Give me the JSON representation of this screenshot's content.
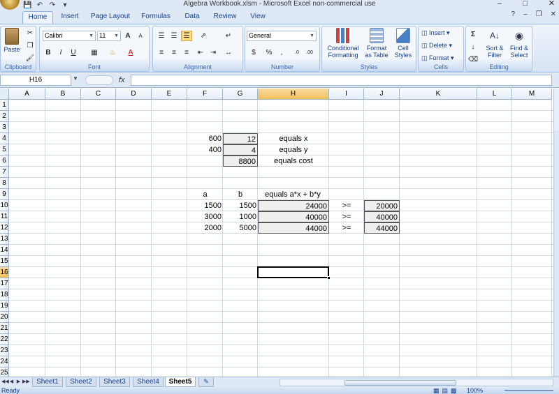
{
  "window": {
    "title": "Algebra Workbook.xlsm  -  Microsoft Excel non-commercial use",
    "buttons": [
      "–",
      "□",
      "✕"
    ]
  },
  "qat": [
    "save-icon",
    "undo-icon",
    "redo-icon",
    "customize-icon"
  ],
  "tabs": [
    "Home",
    "Insert",
    "Page Layout",
    "Formulas",
    "Data",
    "Review",
    "View"
  ],
  "ribbon": {
    "clipboard": {
      "paste": "Paste",
      "label": "Clipboard"
    },
    "font": {
      "name": "Calibri",
      "size": "11",
      "bold": "B",
      "italic": "I",
      "underline": "U",
      "label": "Font"
    },
    "alignment": {
      "label": "Alignment"
    },
    "number": {
      "format": "General",
      "currency": "$",
      "percent": "%",
      "comma": ",",
      "label": "Number"
    },
    "styles": {
      "conditional": "Conditional",
      "conditional2": "Formatting",
      "format_table": "Format",
      "format_table2": "as Table",
      "cell_styles": "Cell",
      "cell_styles2": "Styles",
      "label": "Styles"
    },
    "cells": {
      "insert": "Insert",
      "delete": "Delete",
      "format": "Format",
      "label": "Cells"
    },
    "editing": {
      "sort": "Sort &",
      "sort2": "Filter",
      "find": "Find &",
      "find2": "Select",
      "sigma": "Σ",
      "label": "Editing"
    }
  },
  "formula_bar": {
    "name_box": "H16",
    "fx": "fx",
    "formula": ""
  },
  "columns": [
    "A",
    "B",
    "C",
    "D",
    "E",
    "F",
    "G",
    "H",
    "I",
    "J",
    "K",
    "L",
    "M"
  ],
  "rows": [
    "1",
    "2",
    "3",
    "4",
    "5",
    "6",
    "7",
    "8",
    "9",
    "10",
    "11",
    "12",
    "13",
    "14",
    "15",
    "16",
    "17",
    "18",
    "19",
    "20",
    "21",
    "22",
    "23",
    "24",
    "25"
  ],
  "selected": {
    "column": "H",
    "row": "16"
  },
  "cells": {
    "F4": "600",
    "G4": "12",
    "H4": "equals x",
    "F5": "400",
    "G5": "4",
    "H5": "equals y",
    "G6": "8800",
    "H6": "equals cost",
    "F9": "a",
    "G9": "b",
    "H9": "equals a*x + b*y",
    "F10": "1500",
    "G10": "1500",
    "H10": "24000",
    "I10": ">=",
    "J10": "20000",
    "F11": "3000",
    "G11": "1000",
    "H11": "40000",
    "I11": ">=",
    "J11": "40000",
    "F12": "2000",
    "G12": "5000",
    "H12": "44000",
    "I12": ">=",
    "J12": "44000"
  },
  "sheets": [
    "Sheet1",
    "Sheet2",
    "Sheet3",
    "Sheet4",
    "Sheet5"
  ],
  "active_sheet": "Sheet5",
  "status": {
    "ready": "Ready",
    "zoom": "100%"
  }
}
